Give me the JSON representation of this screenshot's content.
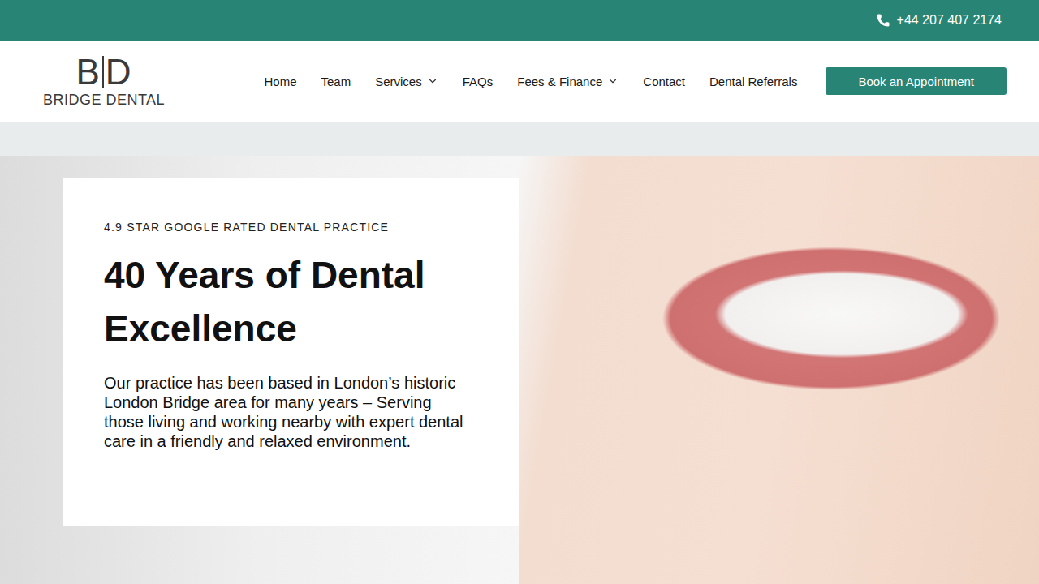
{
  "top_bar": {
    "phone": "+44 207 407 2174"
  },
  "logo": {
    "mark_left": "B",
    "mark_right": "D",
    "name": "BRIDGE DENTAL"
  },
  "nav": {
    "items": [
      {
        "label": "Home",
        "kind": "link"
      },
      {
        "label": "Team",
        "kind": "link"
      },
      {
        "label": "Services",
        "kind": "dropdown"
      },
      {
        "label": "FAQs",
        "kind": "link"
      },
      {
        "label": "Fees & Finance",
        "kind": "dropdown"
      },
      {
        "label": "Contact",
        "kind": "link"
      },
      {
        "label": "Dental Referrals",
        "kind": "link"
      }
    ]
  },
  "cta_button": "Book an Appointment",
  "hero": {
    "eyebrow": "4.9 STAR GOOGLE RATED DENTAL PRACTICE",
    "title": "40 Years of Dental Excellence",
    "body": "Our practice has been based in London’s historic London Bridge area for many years – Serving those living and working nearby with expert dental care in a friendly and relaxed environment."
  }
}
